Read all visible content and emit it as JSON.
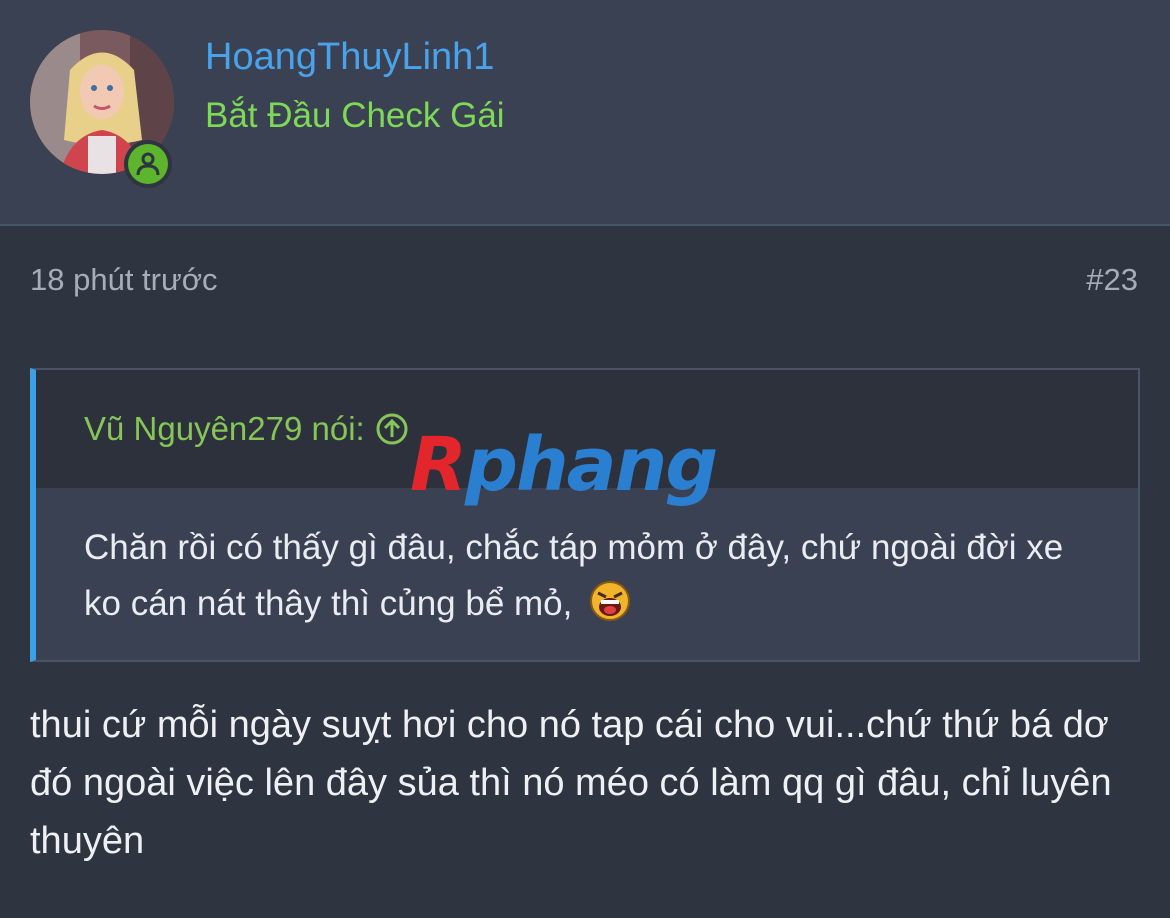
{
  "user": {
    "name": "HoangThuyLinh1",
    "title": "Bắt Đầu Check Gái",
    "status_icon": "online-user-icon"
  },
  "post": {
    "time": "18 phút trước",
    "number": "#23",
    "quote": {
      "author_line": "Vũ Nguyên279 nói:",
      "text": "Chăn rồi có thấy gì đâu, chắc táp mỏm ở đây, chứ ngoài đời xe ko cán nát thây thì củng bể mỏ,",
      "emoji": "laughing-emoji-icon"
    },
    "body": "thui cứ mỗi ngày suỵt hơi cho nó tap cái cho vui...chứ thứ bá dơ đó ngoài việc lên đây sủa thì nó méo có làm qq gì đâu, chỉ luyên thuyên"
  },
  "watermark": {
    "first_letter": "R",
    "rest": "phang"
  },
  "colors": {
    "background": "#2f3441",
    "header_bg": "#3a4152",
    "username": "#4aa3ea",
    "user_title": "#7ed957",
    "quote_author": "#86c558",
    "quote_accent": "#3aa0e8",
    "online_badge": "#5cb52c"
  }
}
